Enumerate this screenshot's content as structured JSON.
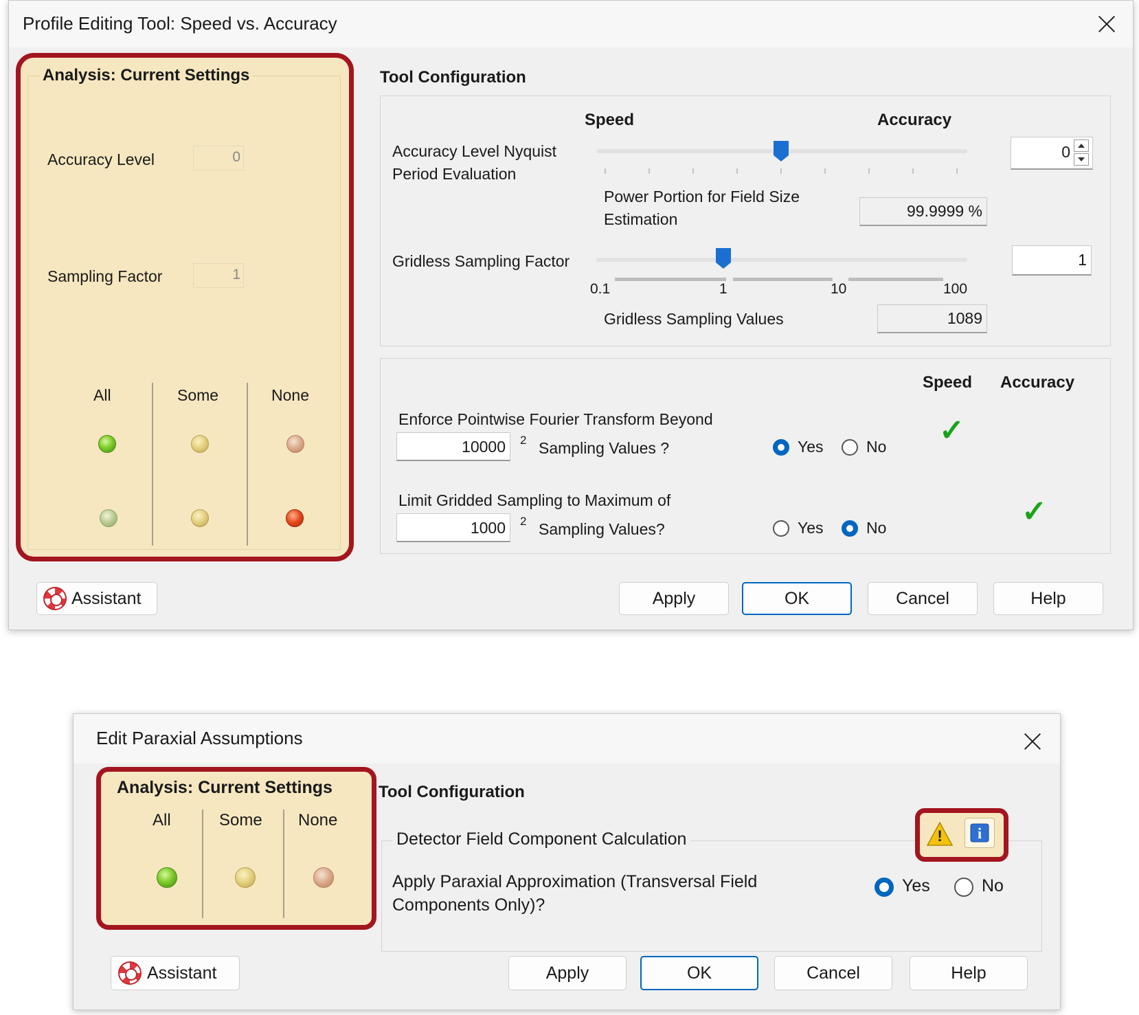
{
  "dialog1": {
    "title": "Profile Editing Tool: Speed vs. Accuracy",
    "analysis": {
      "title": "Analysis: Current Settings",
      "accuracy_level_label": "Accuracy Level",
      "accuracy_level_value": "0",
      "sampling_factor_label": "Sampling Factor",
      "sampling_factor_value": "1",
      "columns": [
        "All",
        "Some",
        "None"
      ]
    },
    "tool_config": {
      "title": "Tool Configuration",
      "speed_label": "Speed",
      "accuracy_label": "Accuracy",
      "accuracy_level_label_line1": "Accuracy Level Nyquist",
      "accuracy_level_label_line2": "Period Evaluation",
      "accuracy_level_value": "0",
      "power_portion_line1": "Power Portion for Field Size",
      "power_portion_line2": "Estimation",
      "power_portion_value": "99.9999 %",
      "gridless_factor_label": "Gridless Sampling Factor",
      "gridless_factor_value": "1",
      "gridless_scale": [
        "0.1",
        "1",
        "10",
        "100"
      ],
      "gridless_values_label": "Gridless Sampling Values",
      "gridless_values_value": "1089"
    },
    "options": {
      "speed_label": "Speed",
      "accuracy_label": "Accuracy",
      "enforce_line1": "Enforce Pointwise Fourier Transform Beyond",
      "enforce_value": "10000",
      "enforce_sup": "2",
      "enforce_line2": "Sampling Values ?",
      "limit_line1": "Limit Gridded Sampling to Maximum of",
      "limit_value": "1000",
      "limit_sup": "2",
      "limit_line2": "Sampling Values?",
      "yes": "Yes",
      "no": "No",
      "check_glyph": "✓"
    },
    "buttons": {
      "assistant": "Assistant",
      "apply": "Apply",
      "ok": "OK",
      "cancel": "Cancel",
      "help": "Help"
    }
  },
  "dialog2": {
    "title": "Edit Paraxial Assumptions",
    "analysis": {
      "title": "Analysis: Current Settings",
      "columns": [
        "All",
        "Some",
        "None"
      ]
    },
    "tool_config": {
      "title": "Tool Configuration",
      "detector_title": "Detector Field Component Calculation",
      "paraxial_line1": "Apply Paraxial Approximation (Transversal Field",
      "paraxial_line2": "Components Only)?",
      "yes": "Yes",
      "no": "No",
      "warning_glyph": "!",
      "info_glyph": "i"
    },
    "buttons": {
      "assistant": "Assistant",
      "apply": "Apply",
      "ok": "OK",
      "cancel": "Cancel",
      "help": "Help"
    }
  },
  "colors": {
    "highlight": "#a3151f",
    "panel_bg": "#f6e7c0",
    "accent": "#0067c0",
    "check": "#1aa31a"
  }
}
